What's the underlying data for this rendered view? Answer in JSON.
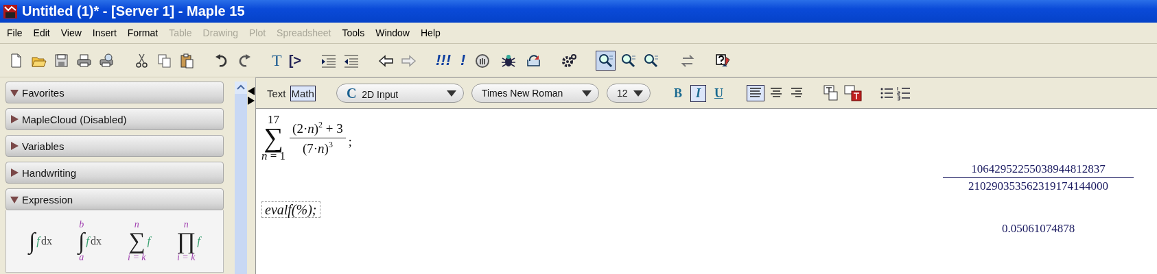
{
  "window": {
    "title": "Untitled (1)* - [Server 1] - Maple 15"
  },
  "menu": [
    {
      "label": "File",
      "disabled": false
    },
    {
      "label": "Edit",
      "disabled": false
    },
    {
      "label": "View",
      "disabled": false
    },
    {
      "label": "Insert",
      "disabled": false
    },
    {
      "label": "Format",
      "disabled": false
    },
    {
      "label": "Table",
      "disabled": true
    },
    {
      "label": "Drawing",
      "disabled": true
    },
    {
      "label": "Plot",
      "disabled": true
    },
    {
      "label": "Spreadsheet",
      "disabled": true
    },
    {
      "label": "Tools",
      "disabled": false
    },
    {
      "label": "Window",
      "disabled": false
    },
    {
      "label": "Help",
      "disabled": false
    }
  ],
  "toolbar": {
    "text_buttons": [
      "T",
      "[>"
    ],
    "execute_buttons": [
      "!!!",
      "!"
    ],
    "zoom_buttons": [
      {
        "selected": true
      },
      {
        "selected": false
      },
      {
        "selected": false
      }
    ]
  },
  "palettes": [
    {
      "label": "Favorites",
      "expanded": true
    },
    {
      "label": "MapleCloud (Disabled)",
      "expanded": false
    },
    {
      "label": "Variables",
      "expanded": false
    },
    {
      "label": "Handwriting",
      "expanded": false
    },
    {
      "label": "Expression",
      "expanded": true,
      "templates": [
        {
          "kind": "integral",
          "symbol": "∫",
          "integrand": "f",
          "differential": "dx"
        },
        {
          "kind": "definite_integral",
          "symbol": "∫",
          "upper": "b",
          "lower": "a",
          "integrand": "f",
          "differential": "dx"
        },
        {
          "kind": "sum",
          "symbol": "∑",
          "upper": "n",
          "lower": "i = k",
          "term": "f"
        },
        {
          "kind": "product",
          "symbol": "∏",
          "upper": "n",
          "lower": "i = k",
          "term": "f"
        }
      ]
    }
  ],
  "doc_toolbar": {
    "modes": [
      {
        "label": "Text",
        "selected": false
      },
      {
        "label": "Math",
        "selected": true
      }
    ],
    "dropdowns": [
      {
        "kind": "style",
        "value": "2D Input",
        "badge": "C"
      },
      {
        "kind": "font",
        "value": "Times New Roman"
      },
      {
        "kind": "size",
        "value": "12"
      }
    ],
    "format_buttons": [
      {
        "label": "B",
        "selected": false
      },
      {
        "label": "I",
        "selected": true
      },
      {
        "label": "U",
        "selected": false
      }
    ],
    "align_buttons": [
      {
        "selected": true
      },
      {
        "selected": false
      },
      {
        "selected": false
      }
    ]
  },
  "document": [
    {
      "kind": "sum_input",
      "symbol": "∑",
      "upper": "17",
      "lower": "*n* = 1",
      "numerator": "(2·*n*)$^{2}$ + 3",
      "denominator": "(7·*n*)$^{3}$",
      "terminator": ";"
    },
    {
      "kind": "fraction_output",
      "numerator": "10642952255038944812837",
      "denominator": "210290353562319174144000"
    },
    {
      "kind": "text_input",
      "text": "evalf(%);"
    },
    {
      "kind": "value_output",
      "text": "0.05061074878"
    }
  ]
}
